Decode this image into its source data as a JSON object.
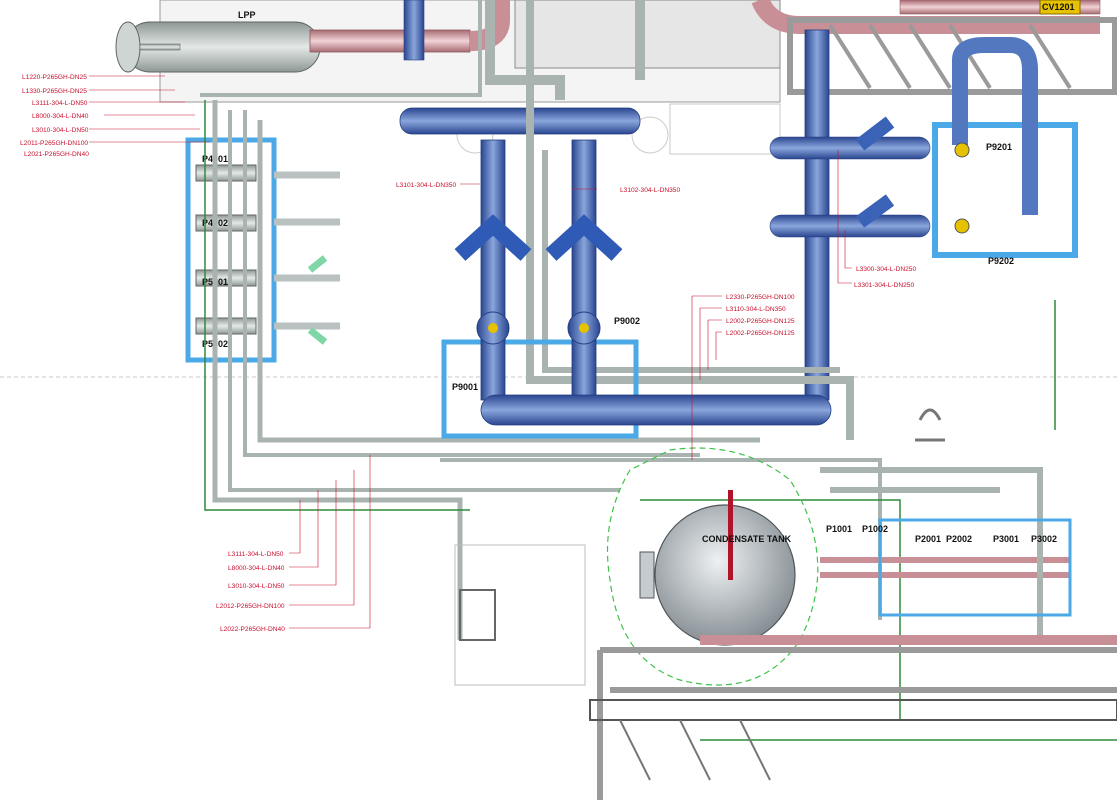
{
  "diagram": {
    "equipment_labels": {
      "lpp": "LPP",
      "cv1201": "CV1201",
      "p4001": "P4001",
      "p4002": "P4002",
      "p5001": "P5001",
      "p5002": "P5002",
      "p9001": "P9001",
      "p9002": "P9002",
      "p9201": "P9201",
      "p9202": "P9202",
      "p1001": "P1001",
      "p1002": "P1002",
      "p2001": "P2001",
      "p2002": "P2002",
      "p3001": "P3001",
      "p3002": "P3002",
      "condensate_tank": "CONDENSATE TANK"
    },
    "pipe_labels": {
      "l1220": "L1220-P265GH-DN25",
      "l1330": "L1330-P265GH-DN25",
      "l3111_top": "L3111-304-L-DN50",
      "l8000_top": "L8000-304-L-DN40",
      "l3010_top": "L3010-304-L-DN50",
      "l2011": "L2011-P265GH-DN100",
      "l2021": "L2021-P265GH-DN40",
      "l3101": "L3101-304-L-DN350",
      "l3102": "L3102-304-L-DN350",
      "l2330": "L2330-P265GH-DN100",
      "l3110": "L3110-304-L-DN350",
      "l2002_a": "L2002-P265GH-DN125",
      "l2002_b": "L2002-P265GH-DN125",
      "l3300": "L3300-304-L-DN250",
      "l3301": "L3301-304-L-DN250",
      "l3111_bot": "L3111-304-L-DN50",
      "l8000_bot": "L8000-304-L-DN40",
      "l3010_bot": "L3010-304-L-DN50",
      "l2012": "L2012-P265GH-DN100",
      "l2022": "L2022-P265GH-DN40"
    },
    "colors": {
      "steel_pipe": "#b9c2c0",
      "blue_pipe": "#4a6fb3",
      "dark_blue": "#2a4a9a",
      "structure_blue": "#4aa9e6",
      "pink_pipe": "#d4a3a8",
      "green_line": "#2e8b3a",
      "label_red": "#c8102e",
      "tank": "#a9b2b8",
      "yellow_valve": "#e6c200"
    }
  }
}
